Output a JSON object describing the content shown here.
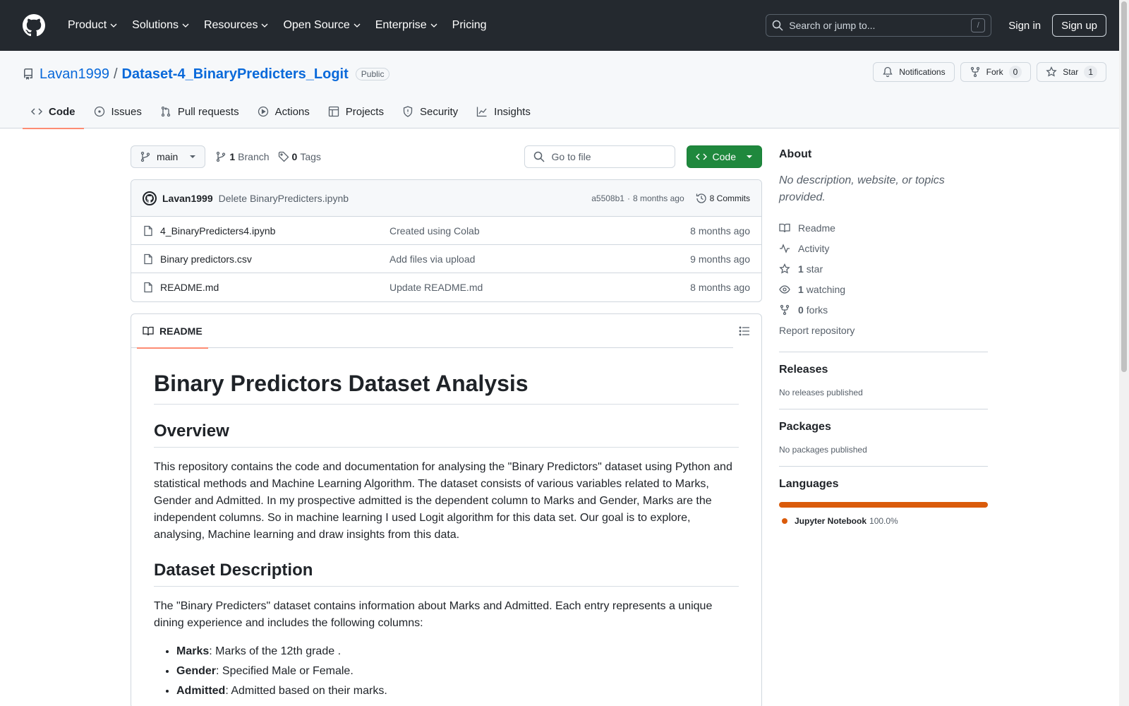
{
  "header": {
    "nav": [
      "Product",
      "Solutions",
      "Resources",
      "Open Source",
      "Enterprise",
      "Pricing"
    ],
    "search_placeholder": "Search or jump to...",
    "search_shortcut": "/",
    "signin": "Sign in",
    "signup": "Sign up"
  },
  "repo": {
    "owner": "Lavan1999",
    "separator": "/",
    "name": "Dataset-4_BinaryPredicters_Logit",
    "visibility": "Public",
    "notifications": "Notifications",
    "fork_label": "Fork",
    "fork_count": "0",
    "star_label": "Star",
    "star_count": "1",
    "tabs": [
      "Code",
      "Issues",
      "Pull requests",
      "Actions",
      "Projects",
      "Security",
      "Insights"
    ]
  },
  "filenav": {
    "branch": "main",
    "branch_count": "1",
    "branch_label": "Branch",
    "tag_count": "0",
    "tag_label": "Tags",
    "goto_placeholder": "Go to file",
    "code_button": "Code"
  },
  "commit": {
    "author": "Lavan1999",
    "message": "Delete BinaryPredicters.ipynb",
    "sha": "a5508b1",
    "dot": "·",
    "age": "8 months ago",
    "commits": "8 Commits"
  },
  "files": [
    {
      "name": "4_BinaryPredicters4.ipynb",
      "commit": "Created using Colab",
      "age": "8 months ago"
    },
    {
      "name": "Binary predictors.csv",
      "commit": "Add files via upload",
      "age": "9 months ago"
    },
    {
      "name": "README.md",
      "commit": "Update README.md",
      "age": "8 months ago"
    }
  ],
  "readme": {
    "tab": "README",
    "h1": "Binary Predictors Dataset Analysis",
    "h2_overview": "Overview",
    "overview": "This repository contains the code and documentation for analysing the \"Binary Predictors\" dataset using Python and statistical methods and Machine Learning Algorithm. The dataset consists of various variables related to Marks, Gender and Admitted. In my prospective admitted is the dependent column to Marks and Gender, Marks are the independent columns. So in machine learning I used Logit algorithm for this data set. Our goal is to explore, analysing, Machine learning and draw insights from this data.",
    "h2_dataset": "Dataset Description",
    "dataset": "The \"Binary Predicters\" dataset contains information about Marks and Admitted. Each entry represents a unique dining experience and includes the following columns:",
    "columns": [
      {
        "name": "Marks",
        "desc": ": Marks of the 12th grade ."
      },
      {
        "name": "Gender",
        "desc": ": Specified Male or Female."
      },
      {
        "name": "Admitted",
        "desc": ": Admitted based on their marks."
      }
    ]
  },
  "sidebar": {
    "about_title": "About",
    "about_desc": "No description, website, or topics provided.",
    "readme": "Readme",
    "activity": "Activity",
    "stars_count": "1",
    "stars_label": "star",
    "watching_count": "1",
    "watching_label": "watching",
    "forks_count": "0",
    "forks_label": "forks",
    "report": "Report repository",
    "releases_title": "Releases",
    "releases_empty": "No releases published",
    "packages_title": "Packages",
    "packages_empty": "No packages published",
    "languages_title": "Languages",
    "language_name": "Jupyter Notebook",
    "language_pct": "100.0%",
    "language_color": "#DA5B0B"
  },
  "colors": {
    "header_bg": "#24292f",
    "link": "#0969da",
    "primary_button": "#1f883d",
    "tab_underline": "#fd8c73"
  }
}
